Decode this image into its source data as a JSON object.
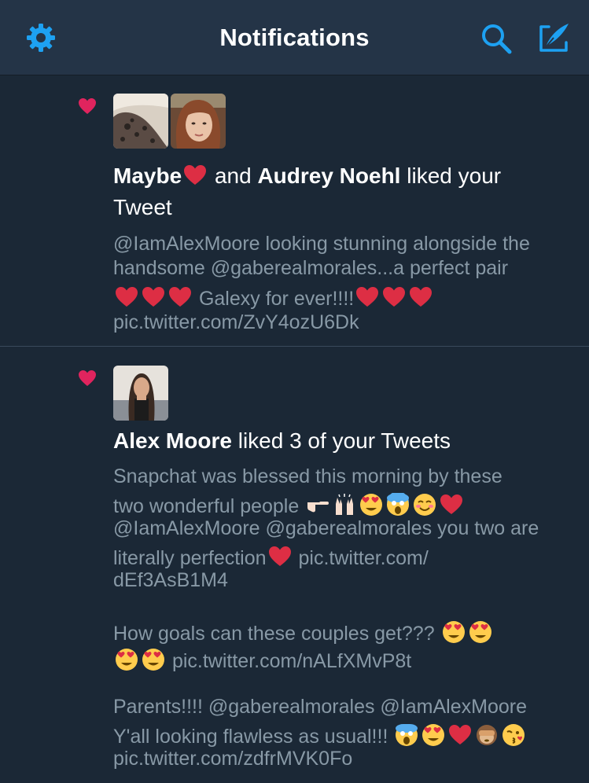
{
  "header": {
    "title": "Notifications",
    "icons": [
      "gear-icon",
      "search-icon",
      "compose-icon"
    ],
    "accent_color": "#1da1f2"
  },
  "notifications": [
    {
      "type": "like",
      "users": [
        "Maybe",
        "Audrey Noehl"
      ],
      "action": {
        "and": "and",
        "liked": "liked your",
        "object": "Tweet"
      },
      "tweet_lines": [
        "@IamAlexMoore looking stunning alongside the",
        "handsome @gaberealmorales...a perfect pair",
        "Galexy for ever!!!!",
        "pic.twitter.com/ZvY4ozU6Dk"
      ]
    },
    {
      "type": "like",
      "users": [
        "Alex Moore"
      ],
      "action": {
        "liked": "liked 3 of your Tweets"
      },
      "tweets": [
        {
          "lines": [
            "Snapchat was blessed this morning by these",
            "two wonderful people",
            "@IamAlexMoore @gaberealmorales you two are",
            "literally perfection",
            "pic.twitter.com/",
            "dEf3AsB1M4"
          ]
        },
        {
          "lines": [
            "How goals can these couples get???",
            "pic.twitter.com/nALfXMvP8t"
          ]
        },
        {
          "lines": [
            "Parents!!!! @gaberealmorales @IamAlexMoore",
            "Y'all looking flawless as usual!!!",
            "pic.twitter.com/zdfrMVK0Fo"
          ]
        }
      ]
    }
  ],
  "colors": {
    "background": "#1b2836",
    "header_background": "#243447",
    "like_heart": "#e0245e",
    "secondary_text": "#8899a6"
  }
}
